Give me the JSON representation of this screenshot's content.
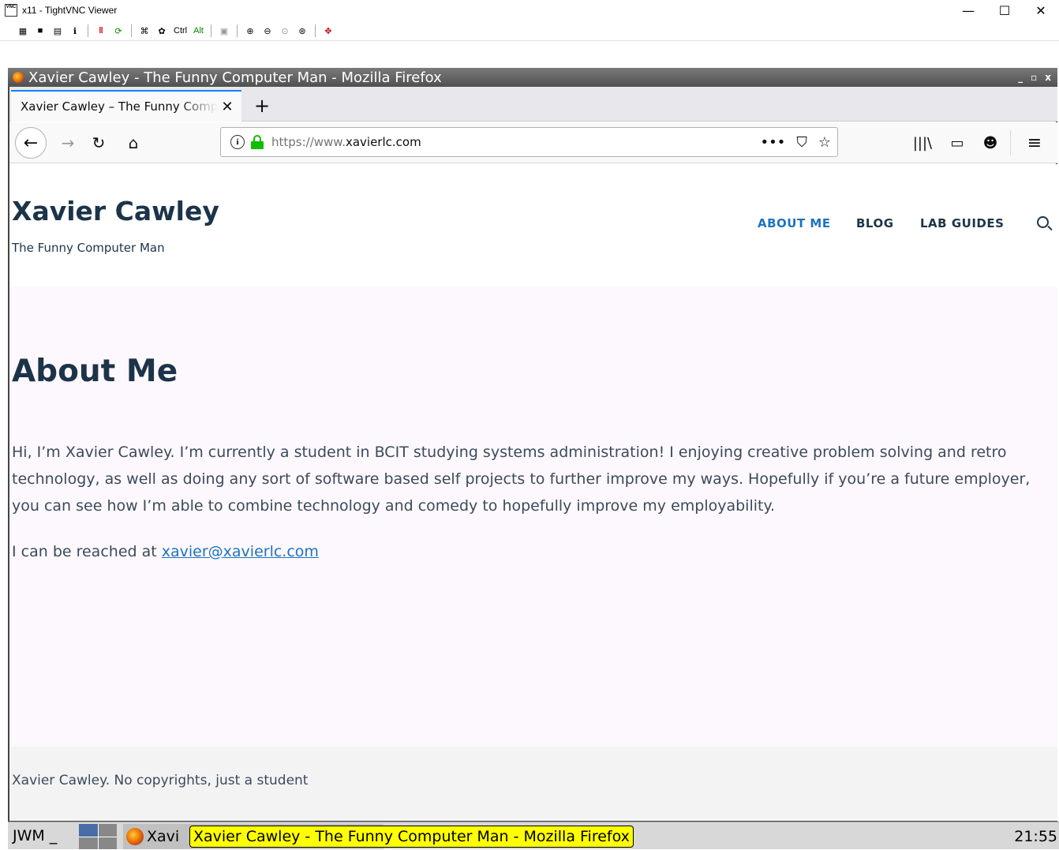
{
  "vnc": {
    "title": "x11 - TightVNC Viewer",
    "icon_text": "VNC",
    "controls": {
      "minimize": "—",
      "maximize": "☐",
      "close": "✕"
    },
    "toolbar": {
      "ctrl_label": "Ctrl",
      "alt_label": "Alt"
    }
  },
  "jwm_window": {
    "title": "Xavier Cawley - The Funny Computer Man - Mozilla Firefox",
    "controls": {
      "minimize": "_",
      "maximize": "▫",
      "close": "x"
    }
  },
  "browser": {
    "tab_title": "Xavier Cawley – The Funny Computer Man",
    "tab_close": "✕",
    "new_tab": "+",
    "url_prefix": "https://www.",
    "url_domain": "xavierlc.com",
    "url_actions": [
      "•••",
      "⛉",
      "☆"
    ],
    "icons": {
      "back": "←",
      "forward": "→",
      "reload": "↻",
      "home": "⌂",
      "library": "|||\\",
      "sidebar": "▭",
      "account": "☻",
      "menu": "≡"
    }
  },
  "site": {
    "title": "Xavier Cawley",
    "tagline": "The Funny Computer Man",
    "nav": [
      {
        "label": "ABOUT ME",
        "active": true
      },
      {
        "label": "BLOG",
        "active": false
      },
      {
        "label": "LAB GUIDES",
        "active": false
      }
    ],
    "heading": "About Me",
    "body": "Hi, I’m Xavier Cawley. I’m currently a student in BCIT studying systems administration! I enjoying creative problem solving and retro technology, as well as doing any sort of software based self projects to further improve my ways. Hopefully if you’re a future employer, you can see how I’m able to combine technology and comedy to hopefully improve my employability.",
    "contact_prefix": "I can be reached at ",
    "contact_email": "xavier@xavierlc.com",
    "footer": "Xavier Cawley. No copyrights, just a student",
    "colors": {
      "title": "#1c3449",
      "accent": "#1e73be",
      "main_bg": "#fdf8fd",
      "footer_bg": "#f4f3f4"
    }
  },
  "taskbar": {
    "menu_label": "JWM _",
    "task_label": "Xavi",
    "tooltip": "Xavier Cawley - The Funny Computer Man - Mozilla Firefox",
    "clock": "21:55"
  }
}
